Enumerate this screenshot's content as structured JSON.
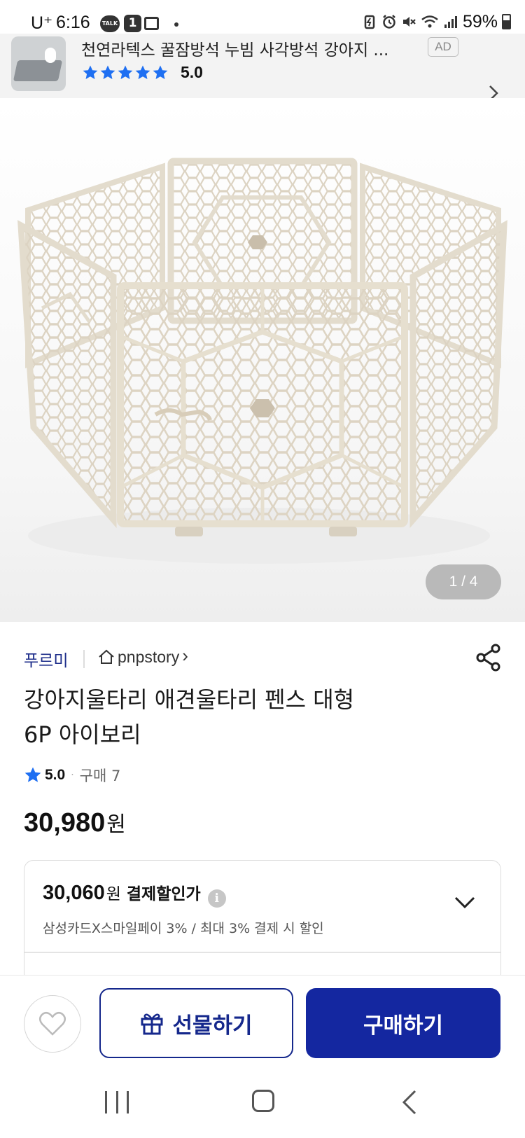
{
  "status_bar": {
    "carrier": "U⁺",
    "time": "6:16",
    "talk_label": "TALK",
    "notification_count": "1",
    "battery": "59%"
  },
  "ad": {
    "title": "천연라텍스 꿀잠방석 누빔 사각방석 강아지 ...",
    "badge": "AD",
    "rating": "5.0",
    "stars": 5,
    "star_color": "#1e6ff2"
  },
  "gallery": {
    "counter": "1 / 4",
    "current": 1,
    "total": 4
  },
  "product": {
    "brand": "푸르미",
    "store": "pnpstory",
    "store_chevron": "›",
    "title_line1": "강아지울타리 애견울타리 펜스 대형",
    "title_line2": "6P 아이보리",
    "rating": "5.0",
    "rating_sep": "·",
    "purchase_count": "구매 7",
    "price": "30,980",
    "price_unit": "원"
  },
  "discount": {
    "price": "30,060",
    "unit": "원",
    "label": "결제할인가",
    "info_icon": "i",
    "description": "삼성카드X스마일페이 3% / 최대 3% 결제 시 할인"
  },
  "actions": {
    "gift_label": "선물하기",
    "buy_label": "구매하기"
  },
  "colors": {
    "brand_navy": "#15288c",
    "buy_button": "#1427a0",
    "star_blue": "#1e6ff2",
    "fence_ivory": "#ebe4d6"
  }
}
